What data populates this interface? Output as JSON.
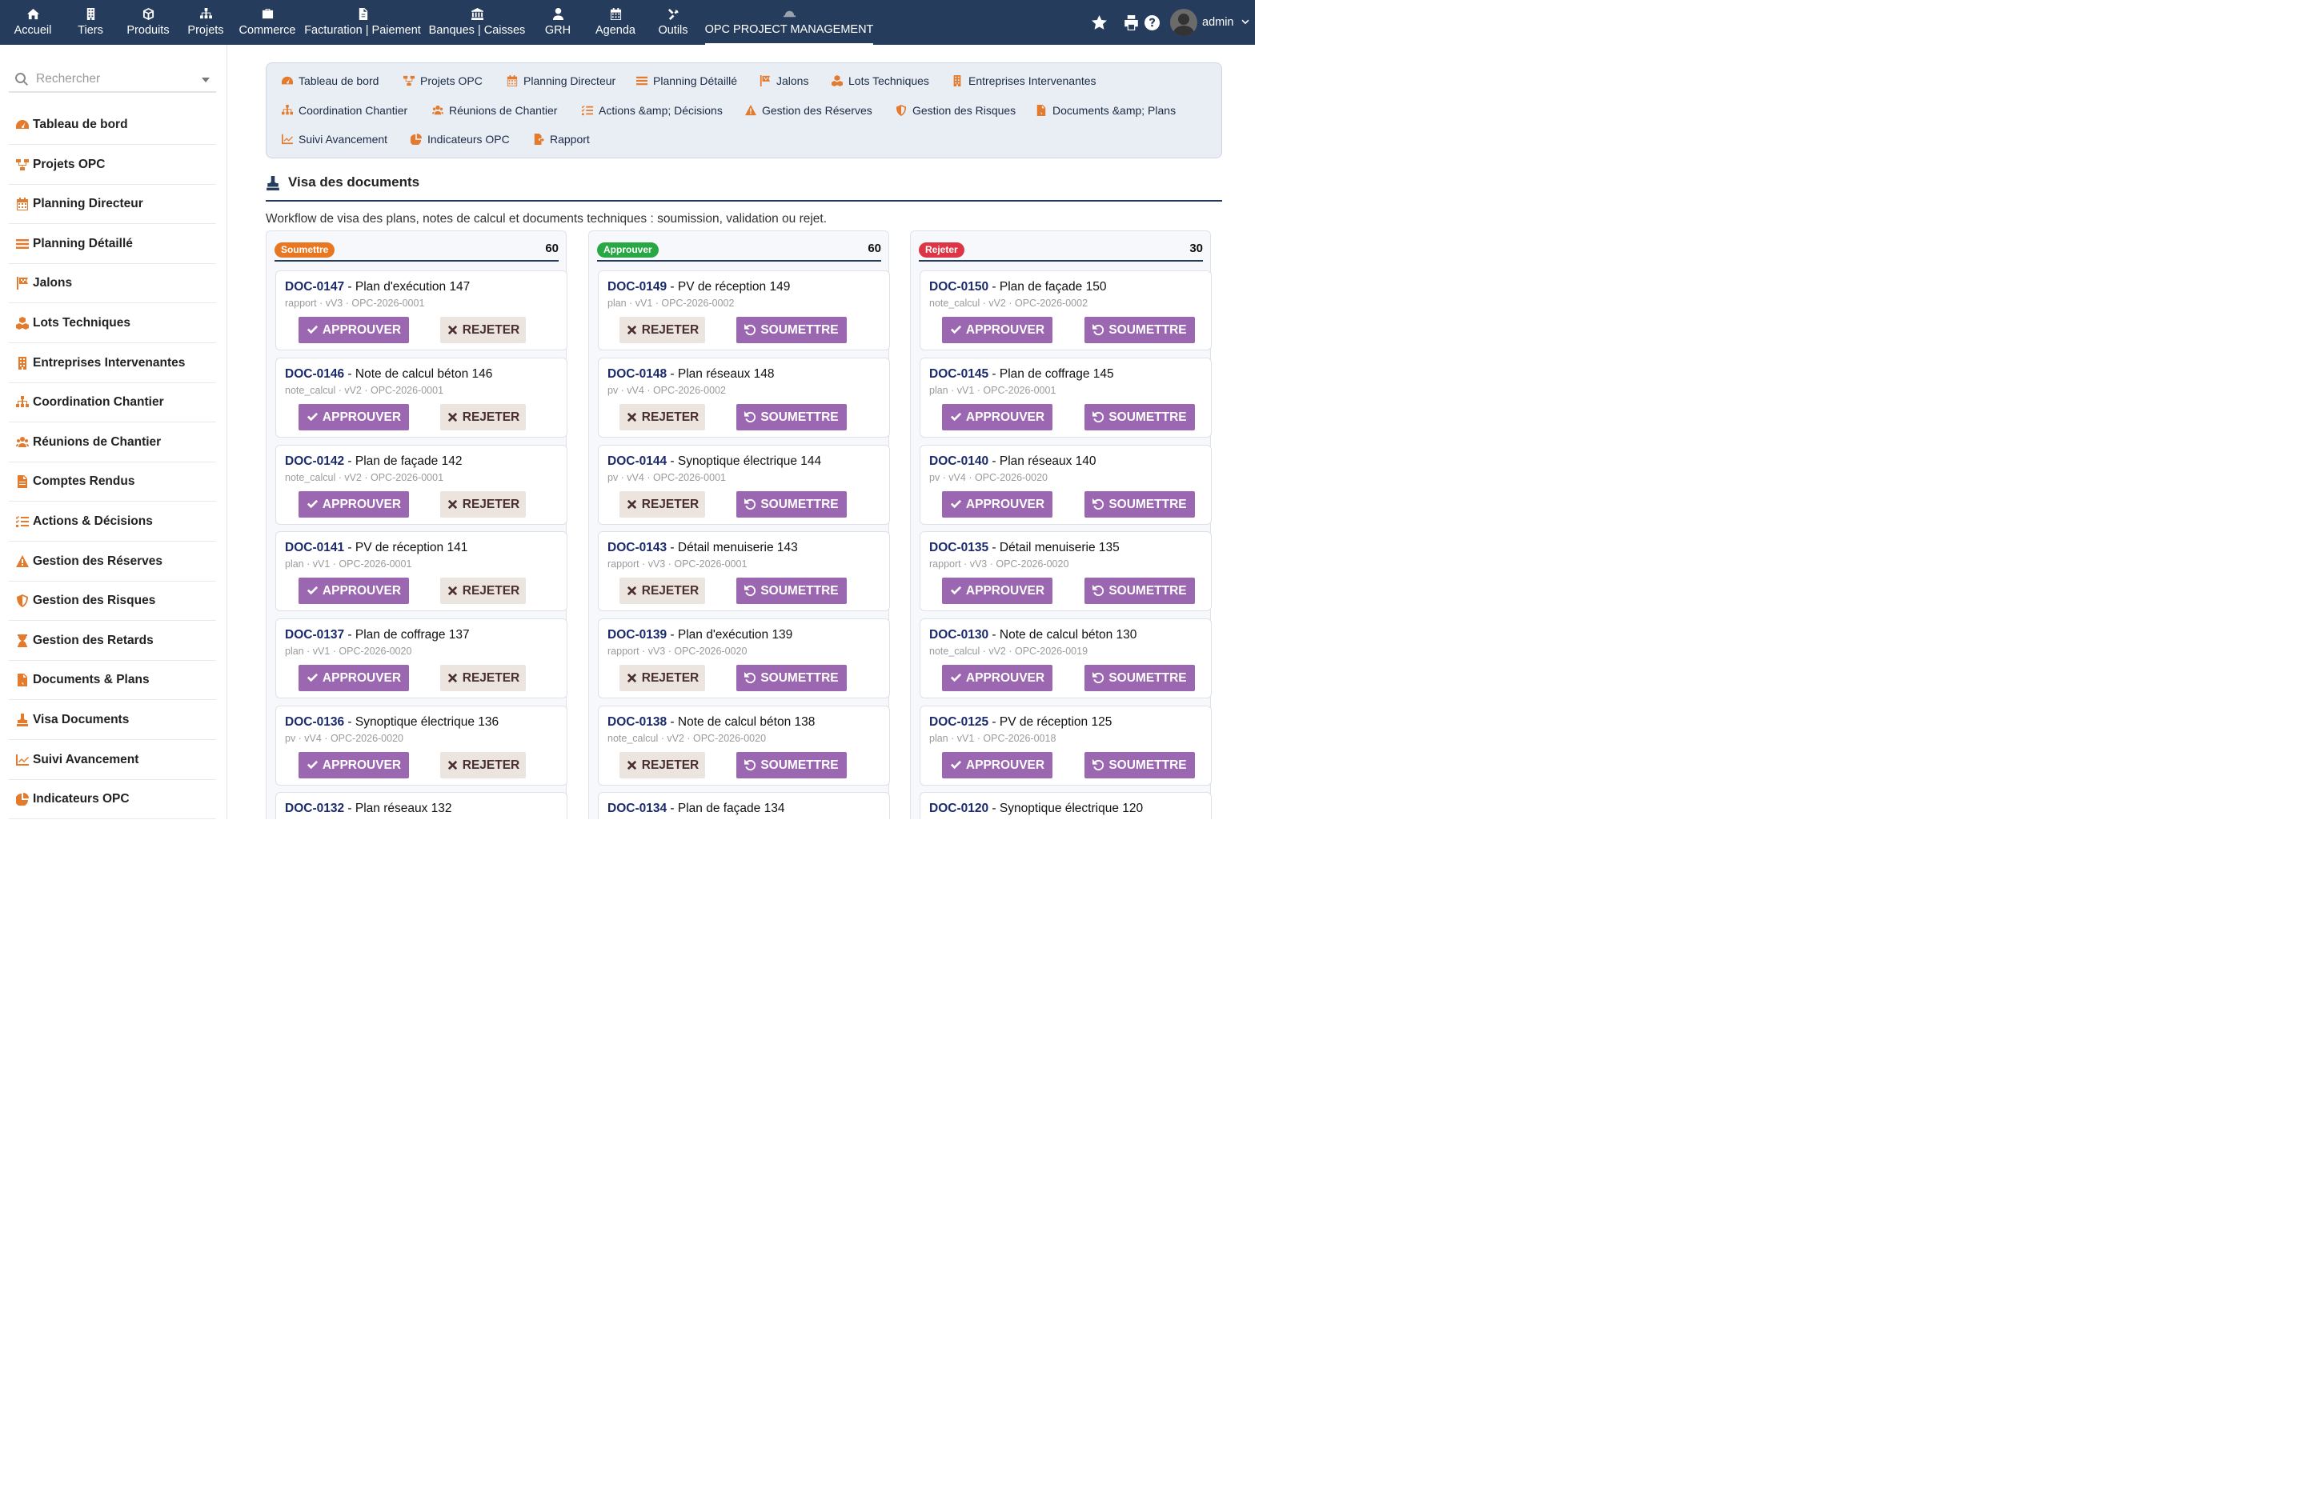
{
  "topnav": {
    "items": [
      {
        "label": "Accueil",
        "icon": "home-icon"
      },
      {
        "label": "Tiers",
        "icon": "building-icon"
      },
      {
        "label": "Produits",
        "icon": "cube-icon"
      },
      {
        "label": "Projets",
        "icon": "sitemap-icon"
      },
      {
        "label": "Commerce",
        "icon": "briefcase-icon"
      },
      {
        "label": "Facturation | Paiement",
        "icon": "invoice-icon"
      },
      {
        "label": "Banques | Caisses",
        "icon": "bank-icon"
      },
      {
        "label": "GRH",
        "icon": "user-tie-icon"
      },
      {
        "label": "Agenda",
        "icon": "calendar-icon"
      },
      {
        "label": "Outils",
        "icon": "tools-icon"
      },
      {
        "label": "OPC PROJECT MANAGEMENT",
        "icon": "hard-hat-icon"
      }
    ],
    "user": "admin"
  },
  "sidebar": {
    "search_placeholder": "Rechercher",
    "items": [
      {
        "label": "Tableau de bord",
        "icon": "gauge-icon"
      },
      {
        "label": "Projets OPC",
        "icon": "project-diagram-icon"
      },
      {
        "label": "Planning Directeur",
        "icon": "calendar-icon"
      },
      {
        "label": "Planning Détaillé",
        "icon": "bars-icon"
      },
      {
        "label": "Jalons",
        "icon": "flag-icon"
      },
      {
        "label": "Lots Techniques",
        "icon": "cubes-icon"
      },
      {
        "label": "Entreprises Intervenantes",
        "icon": "building-icon"
      },
      {
        "label": "Coordination Chantier",
        "icon": "sitemap-icon"
      },
      {
        "label": "Réunions de Chantier",
        "icon": "users-icon"
      },
      {
        "label": "Comptes Rendus",
        "icon": "file-icon"
      },
      {
        "label": "Actions & Décisions",
        "icon": "tasks-icon"
      },
      {
        "label": "Gestion des Réserves",
        "icon": "warning-icon"
      },
      {
        "label": "Gestion des Risques",
        "icon": "shield-icon"
      },
      {
        "label": "Gestion des Retards",
        "icon": "hourglass-icon"
      },
      {
        "label": "Documents & Plans",
        "icon": "file-pdf-icon"
      },
      {
        "label": "Visa Documents",
        "icon": "stamp-icon"
      },
      {
        "label": "Suivi Avancement",
        "icon": "chart-line-icon"
      },
      {
        "label": "Indicateurs OPC",
        "icon": "chart-pie-icon"
      }
    ]
  },
  "subnav": {
    "items": [
      {
        "label": "Tableau de bord",
        "icon": "gauge-icon"
      },
      {
        "label": "Projets OPC",
        "icon": "project-diagram-icon"
      },
      {
        "label": "Planning Directeur",
        "icon": "calendar-icon"
      },
      {
        "label": "Planning Détaillé",
        "icon": "bars-icon"
      },
      {
        "label": "Jalons",
        "icon": "flag-icon"
      },
      {
        "label": "Lots Techniques",
        "icon": "cubes-icon"
      },
      {
        "label": "Entreprises Intervenantes",
        "icon": "building-icon"
      },
      {
        "label": "Coordination Chantier",
        "icon": "sitemap-icon"
      },
      {
        "label": "Réunions de Chantier",
        "icon": "users-icon"
      },
      {
        "label": "Actions &amp; Décisions",
        "icon": "tasks-icon"
      },
      {
        "label": "Gestion des Réserves",
        "icon": "warning-icon"
      },
      {
        "label": "Gestion des Risques",
        "icon": "shield-icon"
      },
      {
        "label": "Documents &amp; Plans",
        "icon": "file-pdf-icon"
      },
      {
        "label": "Suivi Avancement",
        "icon": "chart-line-icon"
      },
      {
        "label": "Indicateurs OPC",
        "icon": "chart-pie-icon"
      },
      {
        "label": "Rapport",
        "icon": "file-export-icon"
      }
    ]
  },
  "page": {
    "title": "Visa des documents",
    "description": "Workflow de visa des plans, notes de calcul et documents techniques : soumission, validation ou rejet."
  },
  "buttons": {
    "approve": "APPROUVER",
    "reject": "REJETER",
    "submit": "SOUMETTRE"
  },
  "colors": {
    "header": "#263c5c",
    "accent_icon": "#e47a2c",
    "badge_submit": "#e87722",
    "badge_approve": "#28a745",
    "badge_reject": "#dc3545",
    "button_purple": "#9b67b0"
  },
  "columns": [
    {
      "badge": "Soumettre",
      "count": "60",
      "cards": [
        {
          "ref": "DOC-0147",
          "title": "Plan d'exécution 147",
          "meta": "rapport · vV3 · OPC-2026-0001"
        },
        {
          "ref": "DOC-0146",
          "title": "Note de calcul béton 146",
          "meta": "note_calcul · vV2 · OPC-2026-0001"
        },
        {
          "ref": "DOC-0142",
          "title": "Plan de façade 142",
          "meta": "note_calcul · vV2 · OPC-2026-0001"
        },
        {
          "ref": "DOC-0141",
          "title": "PV de réception 141",
          "meta": "plan · vV1 · OPC-2026-0001"
        },
        {
          "ref": "DOC-0137",
          "title": "Plan de coffrage 137",
          "meta": "plan · vV1 · OPC-2026-0020"
        },
        {
          "ref": "DOC-0136",
          "title": "Synoptique électrique 136",
          "meta": "pv · vV4 · OPC-2026-0020"
        },
        {
          "ref": "DOC-0132",
          "title": "Plan réseaux 132",
          "meta": ""
        }
      ]
    },
    {
      "badge": "Approuver",
      "count": "60",
      "cards": [
        {
          "ref": "DOC-0149",
          "title": "PV de réception 149",
          "meta": "plan · vV1 · OPC-2026-0002"
        },
        {
          "ref": "DOC-0148",
          "title": "Plan réseaux 148",
          "meta": "pv · vV4 · OPC-2026-0002"
        },
        {
          "ref": "DOC-0144",
          "title": "Synoptique électrique 144",
          "meta": "pv · vV4 · OPC-2026-0001"
        },
        {
          "ref": "DOC-0143",
          "title": "Détail menuiserie 143",
          "meta": "rapport · vV3 · OPC-2026-0001"
        },
        {
          "ref": "DOC-0139",
          "title": "Plan d'exécution 139",
          "meta": "rapport · vV3 · OPC-2026-0020"
        },
        {
          "ref": "DOC-0138",
          "title": "Note de calcul béton 138",
          "meta": "note_calcul · vV2 · OPC-2026-0020"
        },
        {
          "ref": "DOC-0134",
          "title": "Plan de façade 134",
          "meta": ""
        }
      ]
    },
    {
      "badge": "Rejeter",
      "count": "30",
      "cards": [
        {
          "ref": "DOC-0150",
          "title": "Plan de façade 150",
          "meta": "note_calcul · vV2 · OPC-2026-0002"
        },
        {
          "ref": "DOC-0145",
          "title": "Plan de coffrage 145",
          "meta": "plan · vV1 · OPC-2026-0001"
        },
        {
          "ref": "DOC-0140",
          "title": "Plan réseaux 140",
          "meta": "pv · vV4 · OPC-2026-0020"
        },
        {
          "ref": "DOC-0135",
          "title": "Détail menuiserie 135",
          "meta": "rapport · vV3 · OPC-2026-0020"
        },
        {
          "ref": "DOC-0130",
          "title": "Note de calcul béton 130",
          "meta": "note_calcul · vV2 · OPC-2026-0019"
        },
        {
          "ref": "DOC-0125",
          "title": "PV de réception 125",
          "meta": "plan · vV1 · OPC-2026-0018"
        },
        {
          "ref": "DOC-0120",
          "title": "Synoptique électrique 120",
          "meta": ""
        }
      ]
    }
  ]
}
